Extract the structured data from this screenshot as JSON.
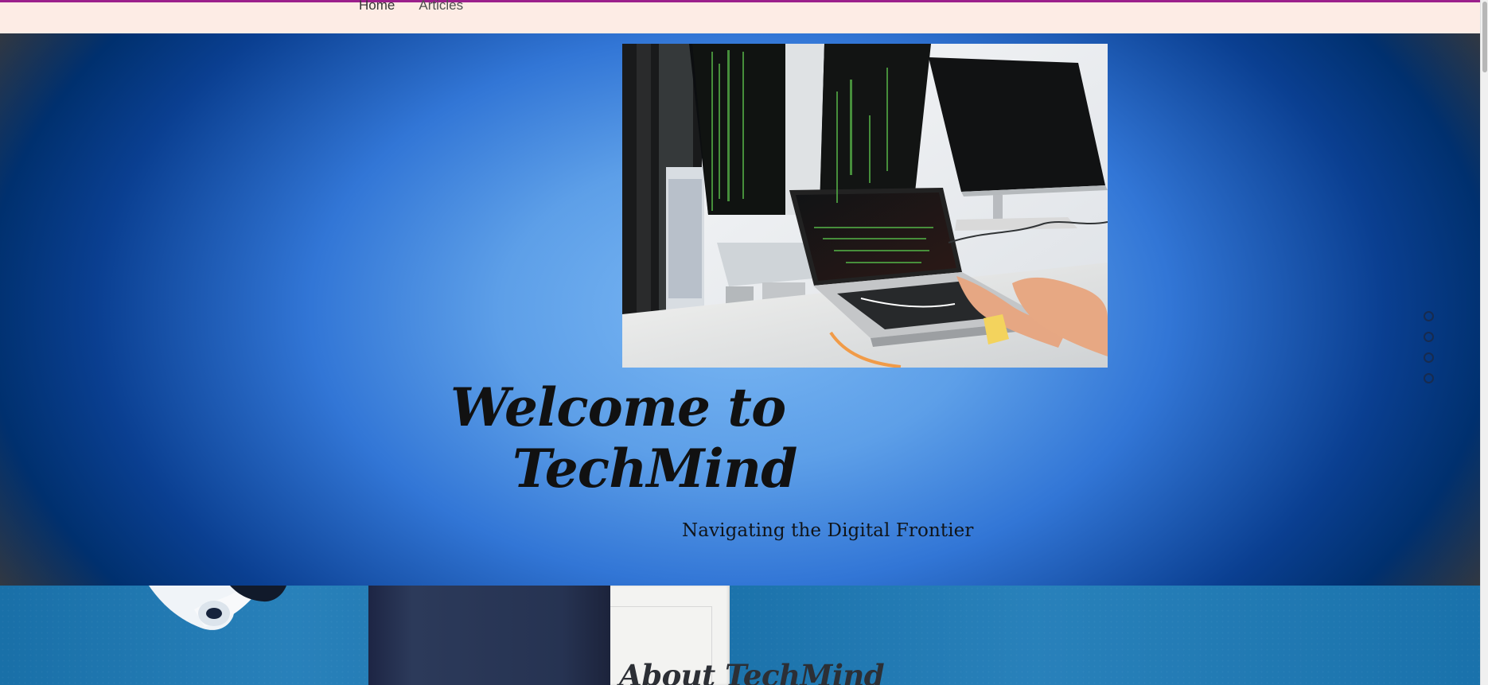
{
  "header": {
    "nav_items": [
      {
        "label": "Home",
        "active": true
      },
      {
        "label": "Articles",
        "active": false
      }
    ],
    "accent_color": "#9c1f8b",
    "background_color": "#fdece5"
  },
  "hero": {
    "image_description_icon": "computer-desk-photo",
    "welcome_title_line_1": "Welcome  to",
    "welcome_title_line_2": "TechMind",
    "tagline": "Navigating the Digital Frontier",
    "slider": {
      "dots": [
        "slide-1",
        "slide-2",
        "slide-3",
        "slide-4"
      ]
    },
    "colors": {
      "hero_center": "#7bb8f4",
      "hero_edge": "#00306e",
      "title": "#111111"
    }
  },
  "about": {
    "title": "About TechMind",
    "background_color": "#1b79b6"
  }
}
